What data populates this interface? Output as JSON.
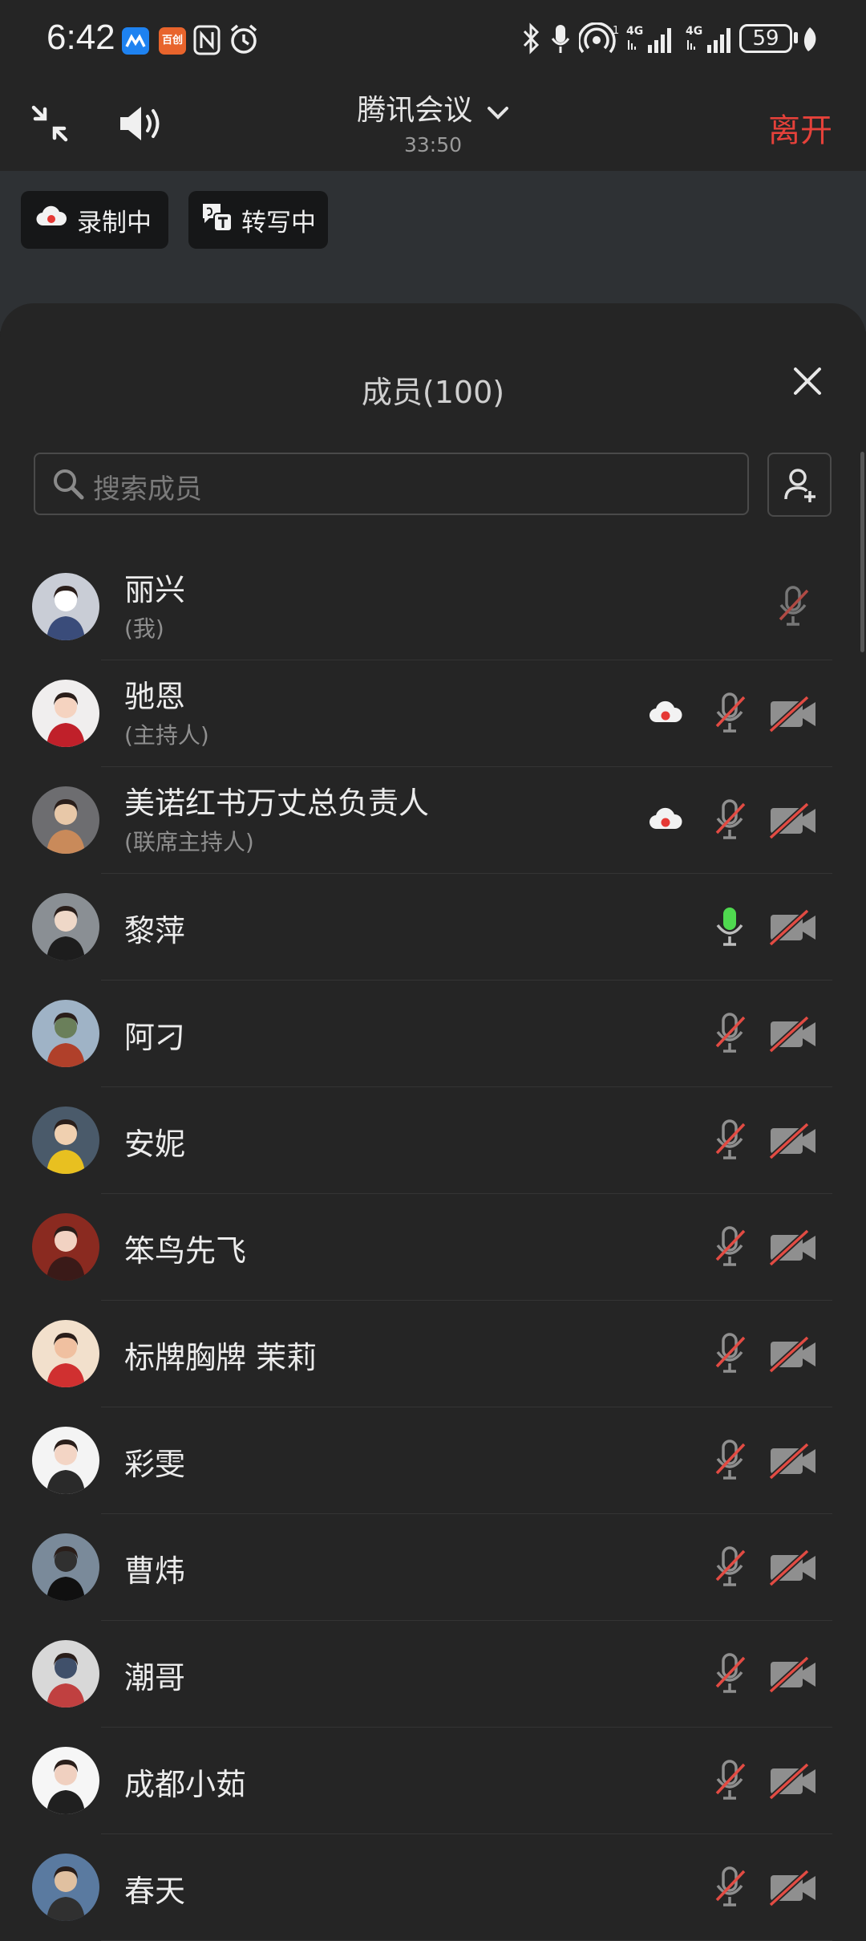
{
  "status_bar": {
    "time": "6:42",
    "app_icon_label": "百创",
    "battery": "59",
    "network_1": "4G",
    "network_2": "4G"
  },
  "header": {
    "title": "腾讯会议",
    "timer": "33:50",
    "leave_label": "离开"
  },
  "chips": {
    "recording": "录制中",
    "transcribing": "转写中"
  },
  "panel": {
    "title": "成员(100)",
    "search_placeholder": "搜索成员"
  },
  "members": [
    {
      "name": "丽兴",
      "role": "(我)",
      "recording": false,
      "mic": "muted-light",
      "camera": "none"
    },
    {
      "name": "驰恩",
      "role": "(主持人)",
      "recording": true,
      "mic": "muted",
      "camera": "off"
    },
    {
      "name": "美诺红书万丈总负责人",
      "role": "(联席主持人)",
      "recording": true,
      "mic": "muted",
      "camera": "off"
    },
    {
      "name": "黎萍",
      "role": "",
      "recording": false,
      "mic": "active",
      "camera": "off"
    },
    {
      "name": "阿刁",
      "role": "",
      "recording": false,
      "mic": "muted",
      "camera": "off"
    },
    {
      "name": "安妮",
      "role": "",
      "recording": false,
      "mic": "muted",
      "camera": "off"
    },
    {
      "name": "笨鸟先飞",
      "role": "",
      "recording": false,
      "mic": "muted",
      "camera": "off"
    },
    {
      "name": "标牌胸牌 茉莉",
      "role": "",
      "recording": false,
      "mic": "muted",
      "camera": "off"
    },
    {
      "name": "彩雯",
      "role": "",
      "recording": false,
      "mic": "muted",
      "camera": "off"
    },
    {
      "name": "曹炜",
      "role": "",
      "recording": false,
      "mic": "muted",
      "camera": "off"
    },
    {
      "name": "潮哥",
      "role": "",
      "recording": false,
      "mic": "muted",
      "camera": "off"
    },
    {
      "name": "成都小茹",
      "role": "",
      "recording": false,
      "mic": "muted",
      "camera": "off"
    },
    {
      "name": "春天",
      "role": "",
      "recording": false,
      "mic": "muted",
      "camera": "off"
    }
  ],
  "colors": {
    "leave": "#e5413a",
    "mic_active": "#4fd94f",
    "mute_slash": "#e24b43",
    "background": "#252525"
  }
}
